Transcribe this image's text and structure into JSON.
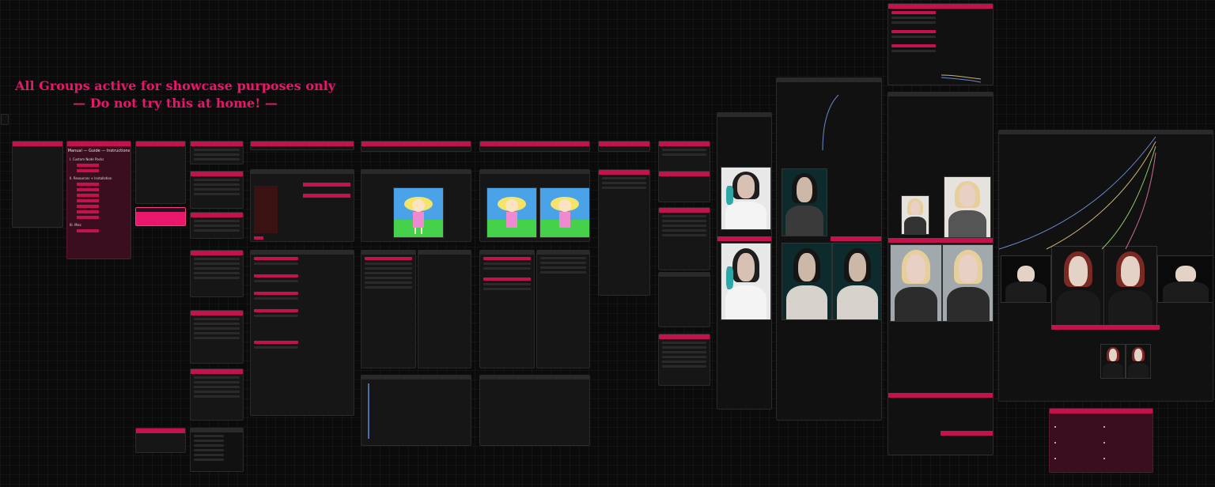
{
  "banner": {
    "line1": "All Groups active for showcase purposes only",
    "line2": "— Do not try this at home! —"
  },
  "manual": {
    "title": "Manual — Guide — Instructions",
    "section1": "I. Custom Node Packs",
    "section2": "II. Resources + Installation",
    "section3": "III. Misc"
  },
  "colors": {
    "accent": "#c4124f",
    "banner_text": "#e8176c",
    "canvas": "#0b0b0c",
    "node_bg": "#161617"
  }
}
